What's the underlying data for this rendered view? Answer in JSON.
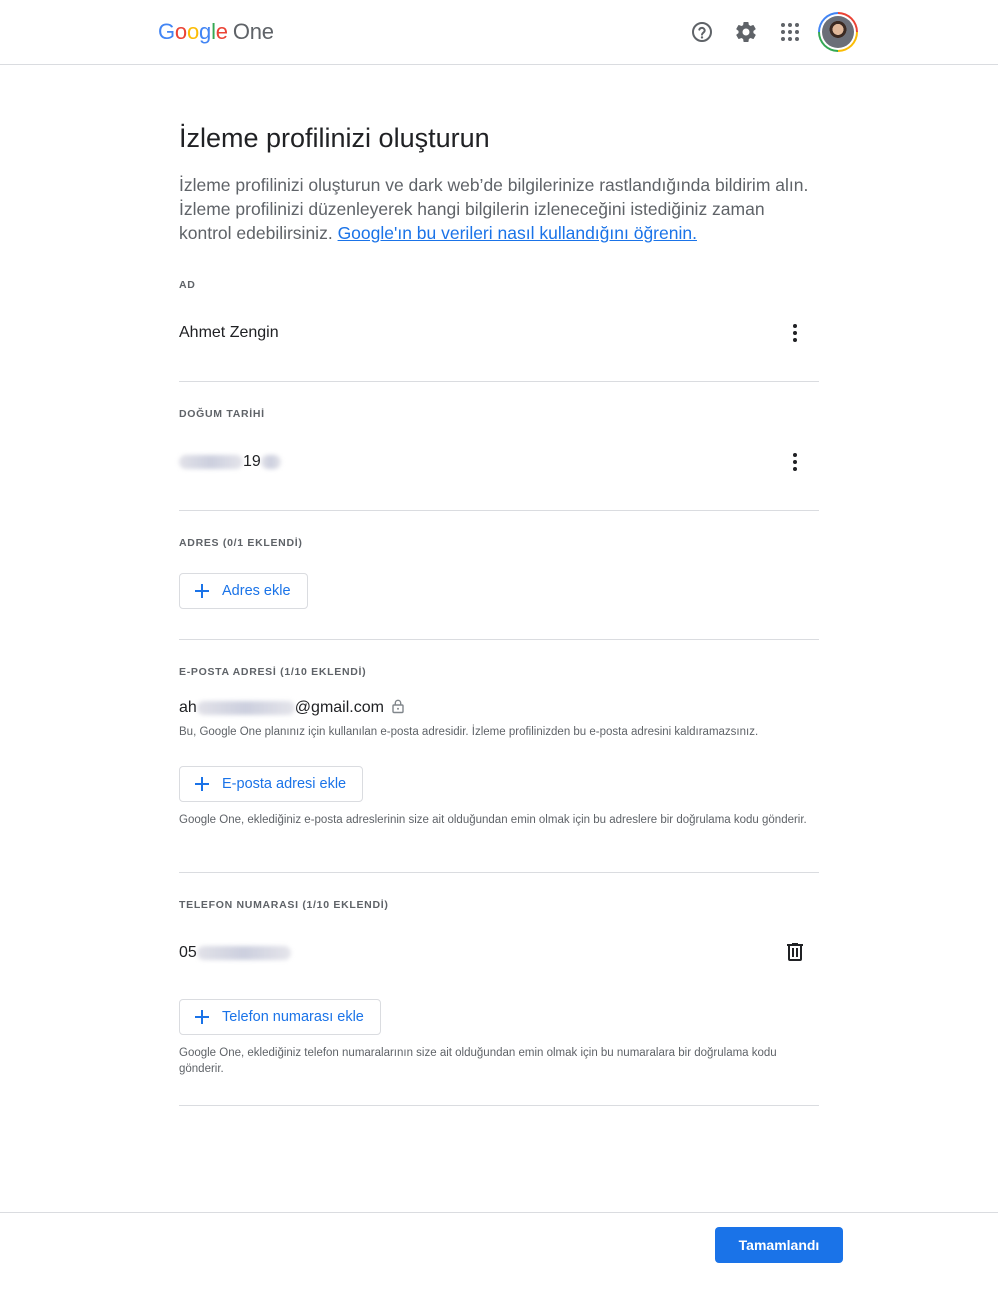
{
  "header": {
    "logo_letters": [
      "G",
      "o",
      "o",
      "g",
      "l",
      "e"
    ],
    "logo_product": "One",
    "icons": [
      "help-icon",
      "settings-icon",
      "apps-icon"
    ]
  },
  "page": {
    "title": "İzleme profilinizi oluşturun",
    "intro_text": "İzleme profilinizi oluşturun ve dark web’de bilgilerinize rastlandığında bildirim alın. İzleme profilinizi düzenleyerek hangi bilgilerin izleneceğini istediğiniz zaman kontrol edebilirsiniz.",
    "intro_link": "Google'ın bu verileri nasıl kullandığını öğrenin."
  },
  "sections": {
    "name": {
      "label": "AD",
      "value": "Ahmet Zengin"
    },
    "birth_date": {
      "label": "DOĞUM TARİHİ",
      "value_visible": "19"
    },
    "address": {
      "label": "ADRES (0/1 EKLENDİ)",
      "add_button": "Adres ekle"
    },
    "email": {
      "label": "E-POSTA ADRESİ (1/10 EKLENDİ)",
      "value_prefix": "ah",
      "value_suffix": "@gmail.com",
      "note": "Bu, Google One planınız için kullanılan e-posta adresidir. İzleme profilinizden bu e-posta adresini kaldıramazsınız.",
      "add_button": "E-posta adresi ekle",
      "help": "Google One, eklediğiniz e-posta adreslerinin size ait olduğundan emin olmak için bu adreslere bir doğrulama kodu gönderir."
    },
    "phone": {
      "label": "TELEFON NUMARASI (1/10 EKLENDİ)",
      "value_prefix": "05",
      "add_button": "Telefon numarası ekle",
      "help": "Google One, eklediğiniz telefon numaralarının size ait olduğundan emin olmak için bu numaralara bir doğrulama kodu gönderir."
    }
  },
  "footer": {
    "done_button": "Tamamlandı"
  },
  "colors": {
    "accent": "#1a73e8",
    "divider": "#dadce0",
    "text_secondary": "#5f6368"
  }
}
